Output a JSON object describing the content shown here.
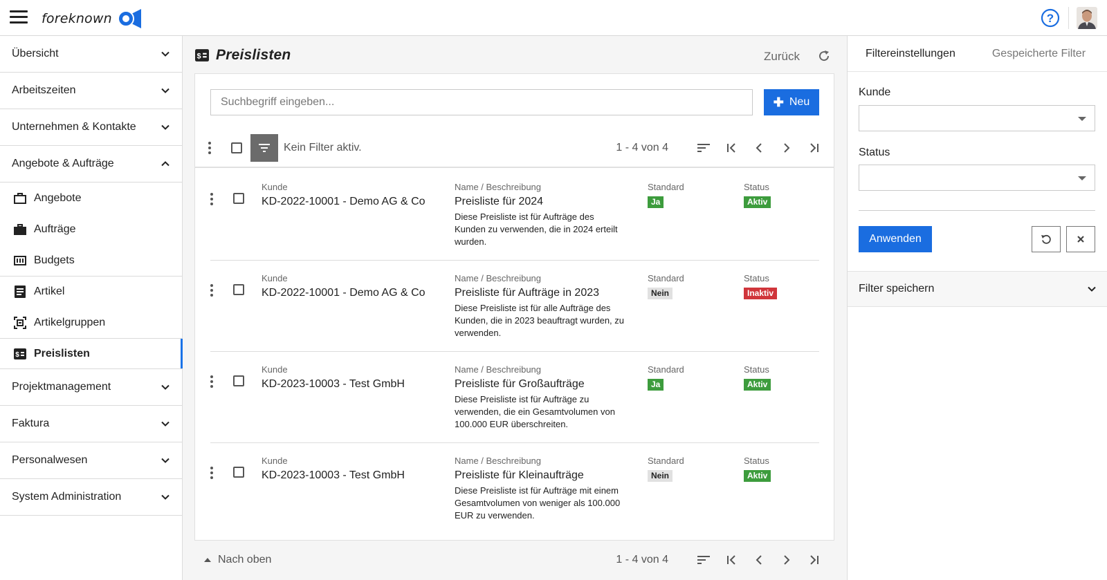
{
  "app": {
    "logo_text": "foreknown",
    "help_icon": "question-circle-icon",
    "avatar": "user-avatar"
  },
  "sidebar": {
    "groups_top": [
      {
        "label": "Übersicht",
        "icon": "chevron-down-icon"
      },
      {
        "label": "Arbeitszeiten",
        "icon": "chevron-down-icon"
      },
      {
        "label": "Unternehmen & Kontakte",
        "icon": "chevron-down-icon"
      },
      {
        "label": "Angebote & Aufträge",
        "icon": "chevron-up-icon"
      }
    ],
    "subitems": [
      {
        "label": "Angebote",
        "icon": "briefcase-outline-icon"
      },
      {
        "label": "Aufträge",
        "icon": "briefcase-icon"
      },
      {
        "label": "Budgets",
        "icon": "budget-counter-icon"
      },
      {
        "label": "Artikel",
        "icon": "document-list-icon"
      },
      {
        "label": "Artikelgruppen",
        "icon": "group-bracket-icon"
      },
      {
        "label": "Preislisten",
        "icon": "price-list-icon",
        "active": true
      }
    ],
    "groups_bottom": [
      {
        "label": "Projektmanagement",
        "icon": "chevron-down-icon"
      },
      {
        "label": "Faktura",
        "icon": "chevron-down-icon"
      },
      {
        "label": "Personalwesen",
        "icon": "chevron-down-icon"
      },
      {
        "label": "System Administration",
        "icon": "chevron-down-icon"
      }
    ]
  },
  "main": {
    "title": "Preislisten",
    "back_label": "Zurück",
    "search_placeholder": "Suchbegriff eingeben...",
    "new_label": "Neu",
    "filter_status": "Kein Filter aktiv.",
    "pager_count": "1 - 4 von 4",
    "to_top_label": "Nach oben",
    "columns": {
      "kunde": "Kunde",
      "name": "Name / Beschreibung",
      "standard": "Standard",
      "status": "Status"
    },
    "rows": [
      {
        "kunde": "KD-2022-10001 - Demo AG & Co",
        "name": "Preisliste für 2024",
        "desc": "Diese Preisliste ist für Aufträge des Kunden zu verwenden, die in 2024 erteilt wurden.",
        "standard": "Ja",
        "status": "Aktiv"
      },
      {
        "kunde": "KD-2022-10001 - Demo AG & Co",
        "name": "Preisliste für Aufträge in 2023",
        "desc": "Diese Preisliste ist für alle Aufträge des Kunden, die in 2023 beauftragt wurden, zu verwenden.",
        "standard": "Nein",
        "status": "Inaktiv"
      },
      {
        "kunde": "KD-2023-10003 - Test GmbH",
        "name": "Preisliste für Großaufträge",
        "desc": "Diese Preisliste ist für Aufträge zu verwenden, die ein Gesamtvolumen von 100.000 EUR überschreiten.",
        "standard": "Ja",
        "status": "Aktiv"
      },
      {
        "kunde": "KD-2023-10003 - Test GmbH",
        "name": "Preisliste für Kleinaufträge",
        "desc": "Diese Preisliste ist für Aufträge mit einem Gesamtvolumen von weniger als 100.000 EUR zu verwenden.",
        "standard": "Nein",
        "status": "Aktiv"
      }
    ]
  },
  "filter_panel": {
    "tab_settings": "Filtereinstellungen",
    "tab_saved": "Gespeicherte Filter",
    "kunde_label": "Kunde",
    "kunde_value": "",
    "status_label": "Status",
    "status_value": "",
    "apply_label": "Anwenden",
    "save_filter_label": "Filter speichern"
  },
  "colors": {
    "accent": "#1a6de0",
    "badge_green": "#3d9c3d",
    "badge_red": "#d0353b",
    "badge_grey": "#e1e1e1"
  }
}
